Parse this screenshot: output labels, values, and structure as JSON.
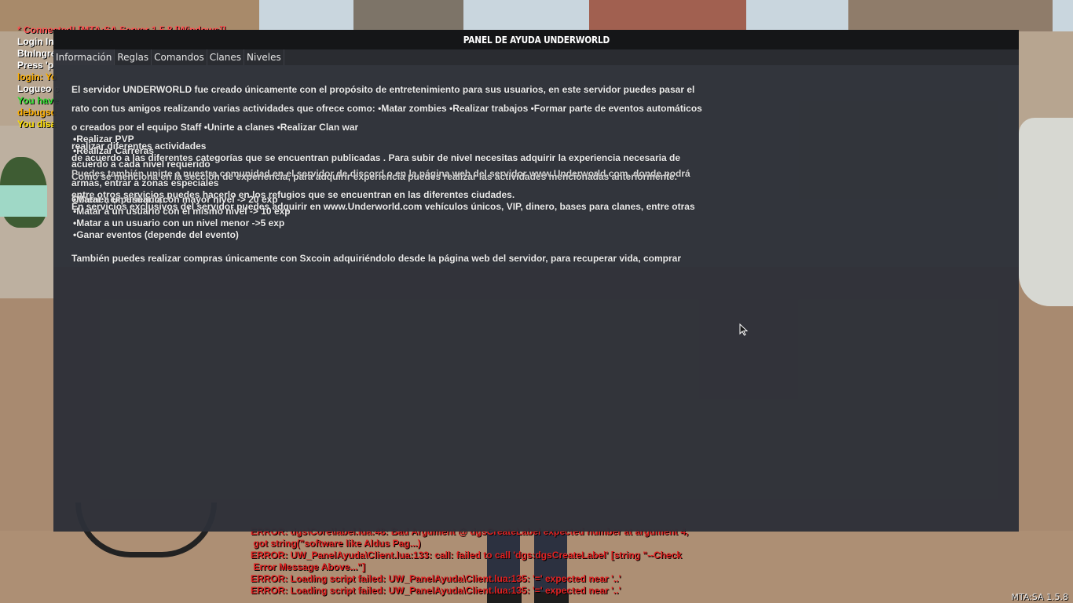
{
  "chat": [
    {
      "text": "* Connected! [MTA:SA Server 1.5.8 [Windows]]",
      "color": "#ff5252"
    },
    {
      "text": "Login Init - Login",
      "color": "#ffffff"
    },
    {
      "text": "BtnIngresar",
      "color": "#ffffff"
    },
    {
      "text": "Press 'p'",
      "color": "#ffffff"
    },
    {
      "text": "login: Yo",
      "color": "#ffb000"
    },
    {
      "text": "Logueo c",
      "color": "#ffffff"
    },
    {
      "text": "You have",
      "color": "#33e033"
    },
    {
      "text": "debugsc",
      "color": "#ffb000"
    },
    {
      "text": "You disa",
      "color": "#ffe100"
    }
  ],
  "panel": {
    "title": "PANEL DE AYUDA UNDERWORLD",
    "tabs": [
      {
        "label": "Información",
        "active": true
      },
      {
        "label": "Reglas",
        "active": false
      },
      {
        "label": "Comandos",
        "active": false
      },
      {
        "label": "Clanes",
        "active": false
      },
      {
        "label": "Niveles",
        "active": false
      }
    ],
    "info_lines": [
      "El servidor UNDERWORLD fue creado únicamente con el propósito de entretenimiento para sus usuarios, en este servidor puedes pasar el",
      "rato con tus amigos realizando varias actividades que ofrece como: •Matar zombies •Realizar trabajos •Formar parte de eventos automáticos",
      "o creados por el equipo Staff •Unirte a clanes •Realizar Clan war",
      "realizar diferentes actividades",
      "Puedes también unirte a nuestra comunidad en el servidor de discord o en la página web del servidor www.Underworld.com, donde podrá",
      "entre otros servicios puedes hacerlo en los refugios que se encuentran en las diferentes ciudades.",
      "En servicios exclusivos del servidor puedes adquirir en www.Underworld.com vehículos únicos, VIP, dinero, bases para clanes, entre otras",
      "También puedes realizar compras únicamente con Sxcoin adquiriéndolo desde la página web del servidor, para recuperar vida, comprar",
      "armas, entrar a zonas especiales"
    ],
    "overlap_lines": [
      "•Realizar PVP",
      "•Realizar Carreras",
      "de acuerdo a las diferentes categorías que se encuentran publicadas . Para subir de nivel necesitas adquirir la experiencia necesaria de",
      "acuerdo a cada nivel requerido",
      "Como se menciona en la sección de experiencia, para adquirir experiencia puedes realizar las actividades mencionadas anteriormente.",
      "Obtener experiencia:",
      "•Matar a un usuario con mayor nivel -> 20 exp",
      "•Matar a un usuario con el mismo nivel -> 10 exp",
      "•Matar a un usuario con un nivel menor ->5 exp",
      "•Ganar eventos (depende del evento)"
    ]
  },
  "debug": [
    "ERROR: dgs\\Core\\label.lua:48: Bad Argument @ dgsCreateLabel expected number at argument 4,",
    " got string(\"software like Aldus Pag...)",
    "ERROR: UW_PanelAyuda\\Client.lua:133: call: failed to call 'dgs:dgsCreateLabel' [string \"--Check",
    " Error Message Above...\"]",
    "ERROR: Loading script failed: UW_PanelAyuda\\Client.lua:135: '=' expected near '..'",
    "ERROR: Loading script failed: UW_PanelAyuda\\Client.lua:135: '=' expected near '..'"
  ],
  "version": "MTA:SA 1.5.8"
}
